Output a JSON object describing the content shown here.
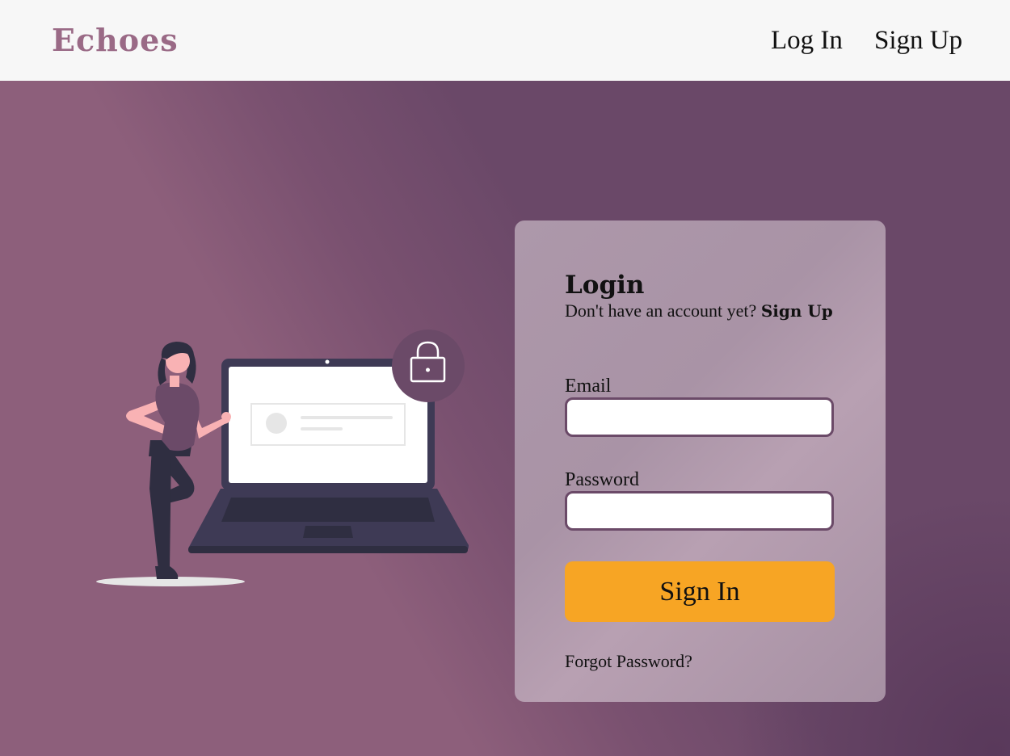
{
  "header": {
    "brand": "Echoes",
    "nav": {
      "login_label": "Log In",
      "signup_label": "Sign Up"
    }
  },
  "login_card": {
    "title": "Login",
    "prompt_text": "Don't have an account yet? ",
    "signup_link": "Sign Up",
    "email_label": "Email",
    "email_value": "",
    "password_label": "Password",
    "password_value": "",
    "submit_label": "Sign In",
    "forgot_label": "Forgot Password?"
  },
  "illustration": {
    "icon": "lock-icon",
    "subject": "person-leaning-on-laptop"
  },
  "colors": {
    "brand": "#9a6a86",
    "header_bg": "#f7f7f7",
    "hero_bg": "#7a5170",
    "card_bg": "#ad98aa",
    "input_border": "#6b4a68",
    "button_bg": "#f7a524",
    "laptop_frame": "#3e3a55",
    "shirt": "#6b4a68",
    "skin": "#f9b2b4"
  }
}
